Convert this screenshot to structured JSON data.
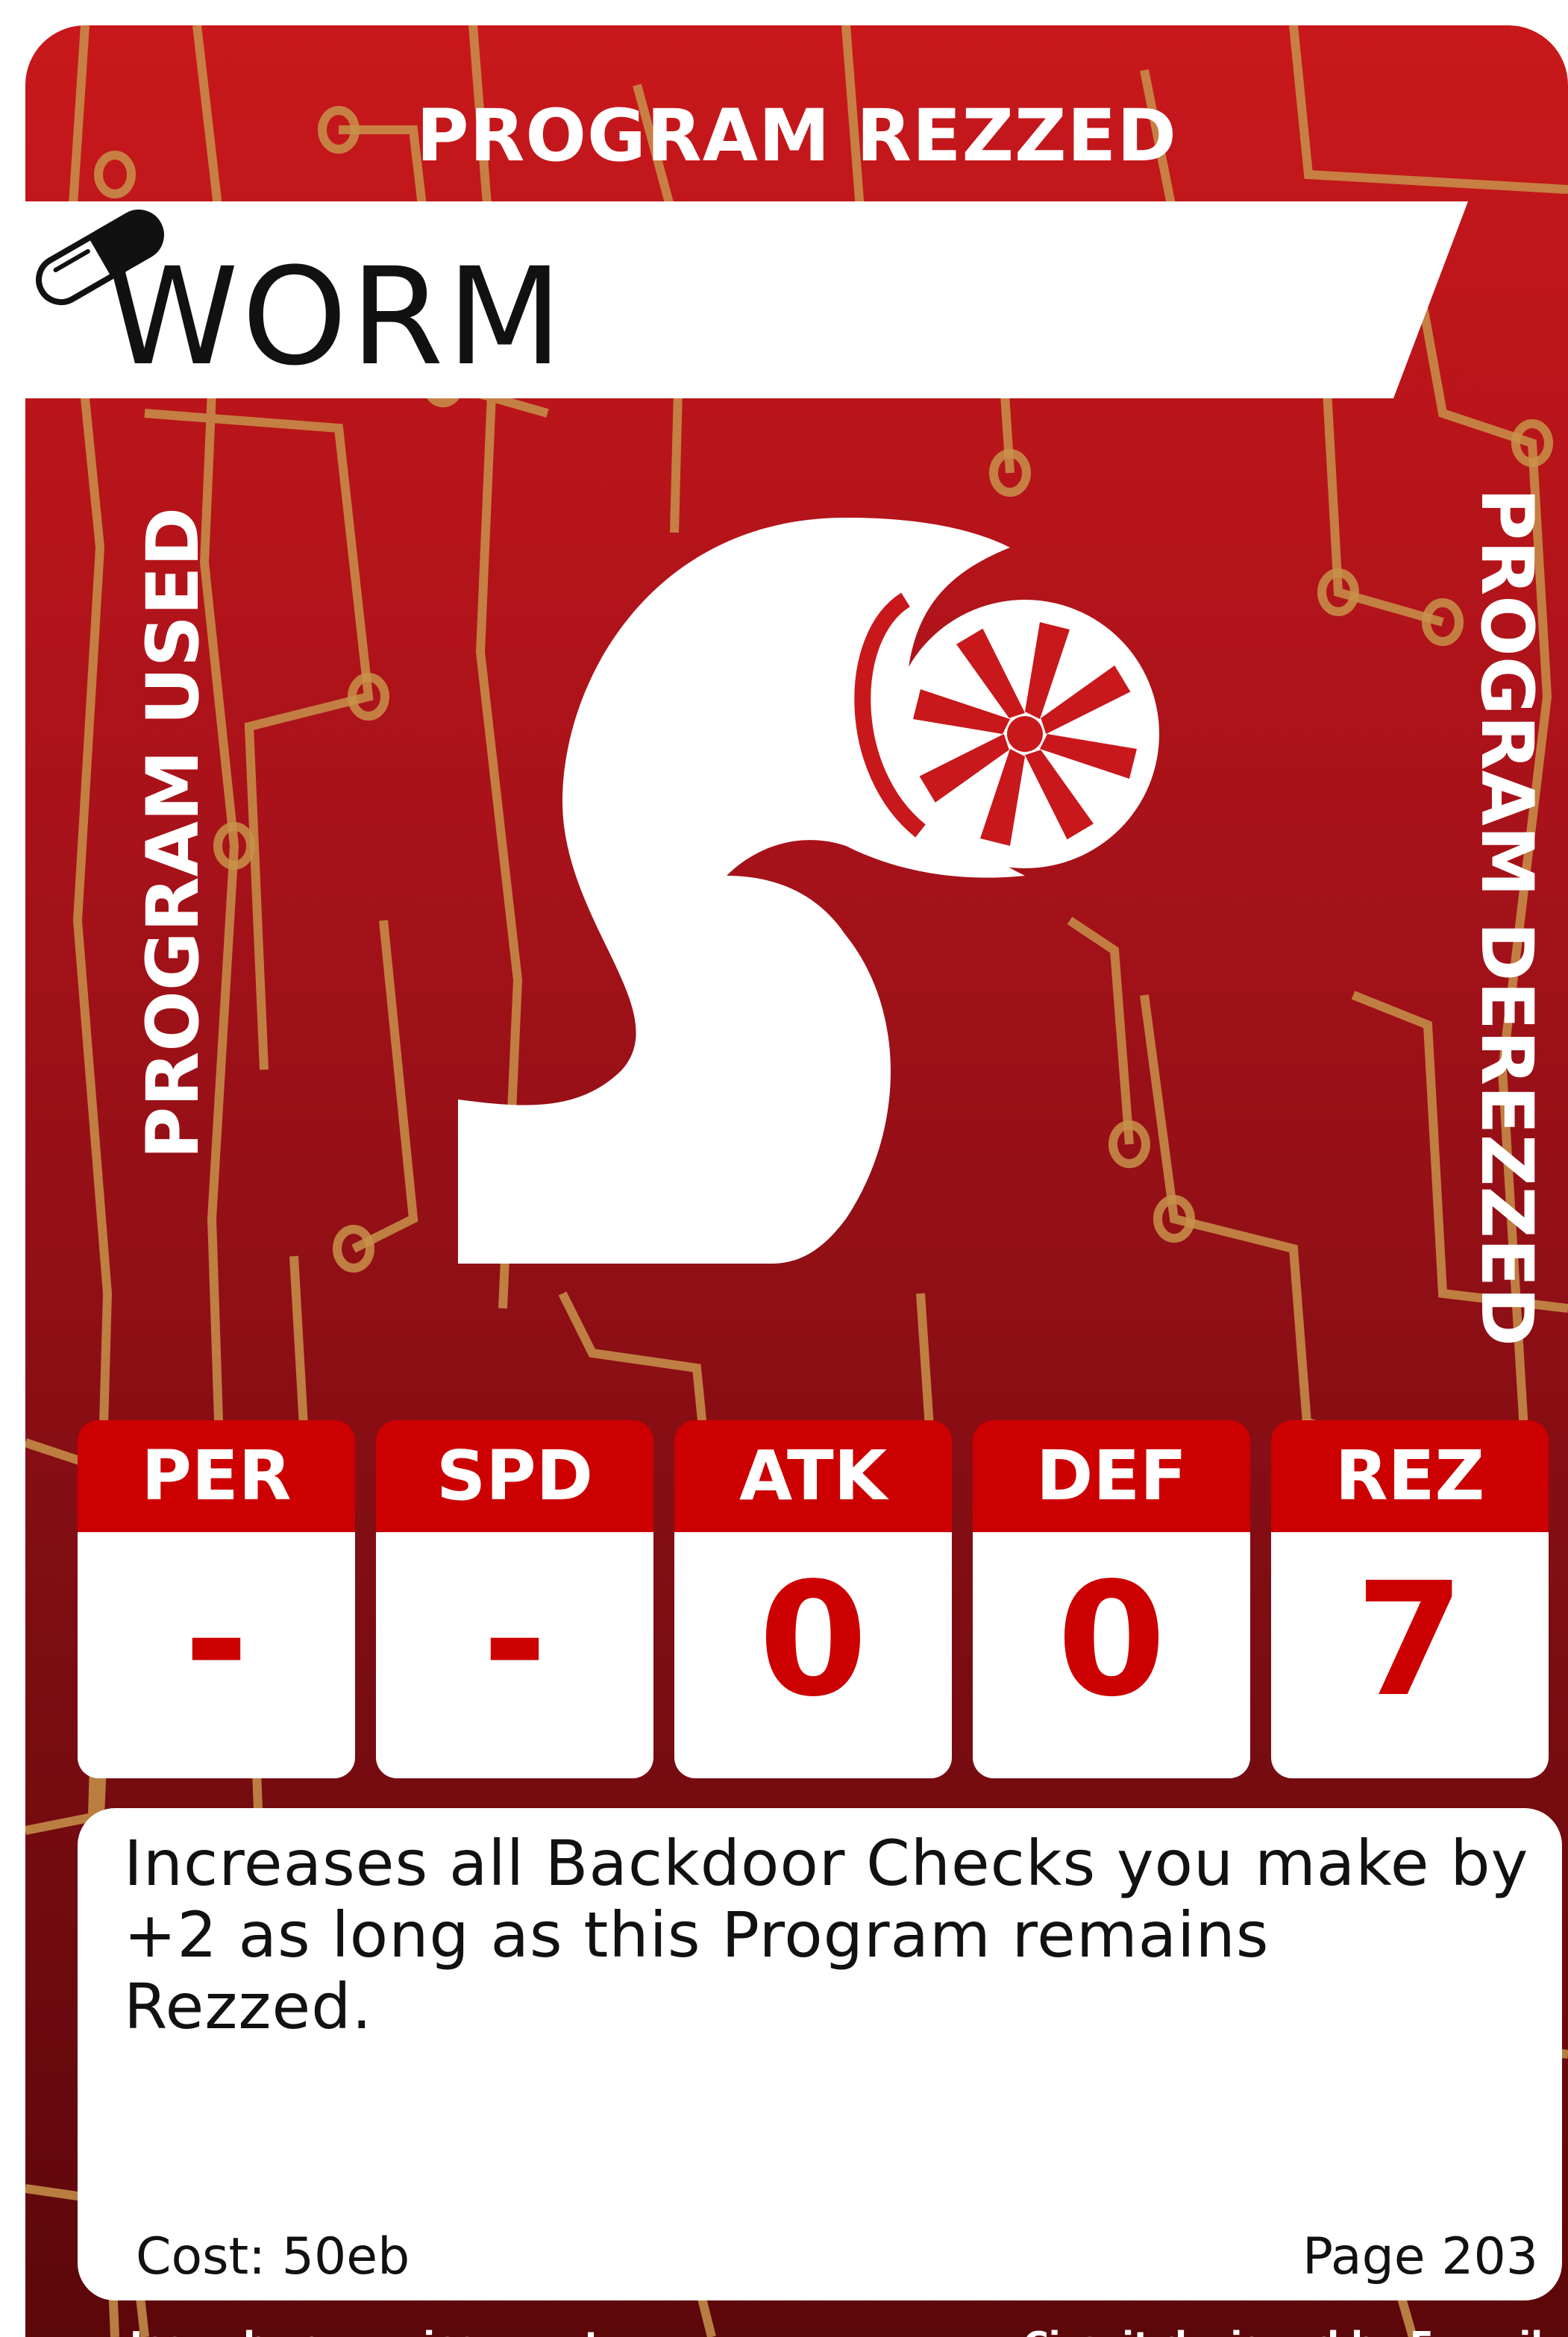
{
  "card": {
    "top_label": "PROGRAM REZZED",
    "title": "WORM",
    "left_label": "PROGRAM USED",
    "right_label": "PROGRAM DEREZZED",
    "title_icon": "pill-capsule-icon",
    "art_icon": "worm-turbine-icon"
  },
  "stats": [
    {
      "label": "PER",
      "value": "-"
    },
    {
      "label": "SPD",
      "value": "-"
    },
    {
      "label": "ATK",
      "value": "0"
    },
    {
      "label": "DEF",
      "value": "0"
    },
    {
      "label": "REZ",
      "value": "7"
    }
  ],
  "text": {
    "description": "Increases all Backdoor Checks you make by +2 as long as this Program remains Rezzed.",
    "cost": "Cost: 50eb",
    "page": "Page 203"
  },
  "credits": {
    "icons": "Icons by game-icons.net",
    "circuit": "Circuit designed by Freepik"
  },
  "colors": {
    "card_red": "#c8181b",
    "card_dark": "#5c070a",
    "stat_red": "#cc0000",
    "circuit_gold": "#c8924a"
  }
}
